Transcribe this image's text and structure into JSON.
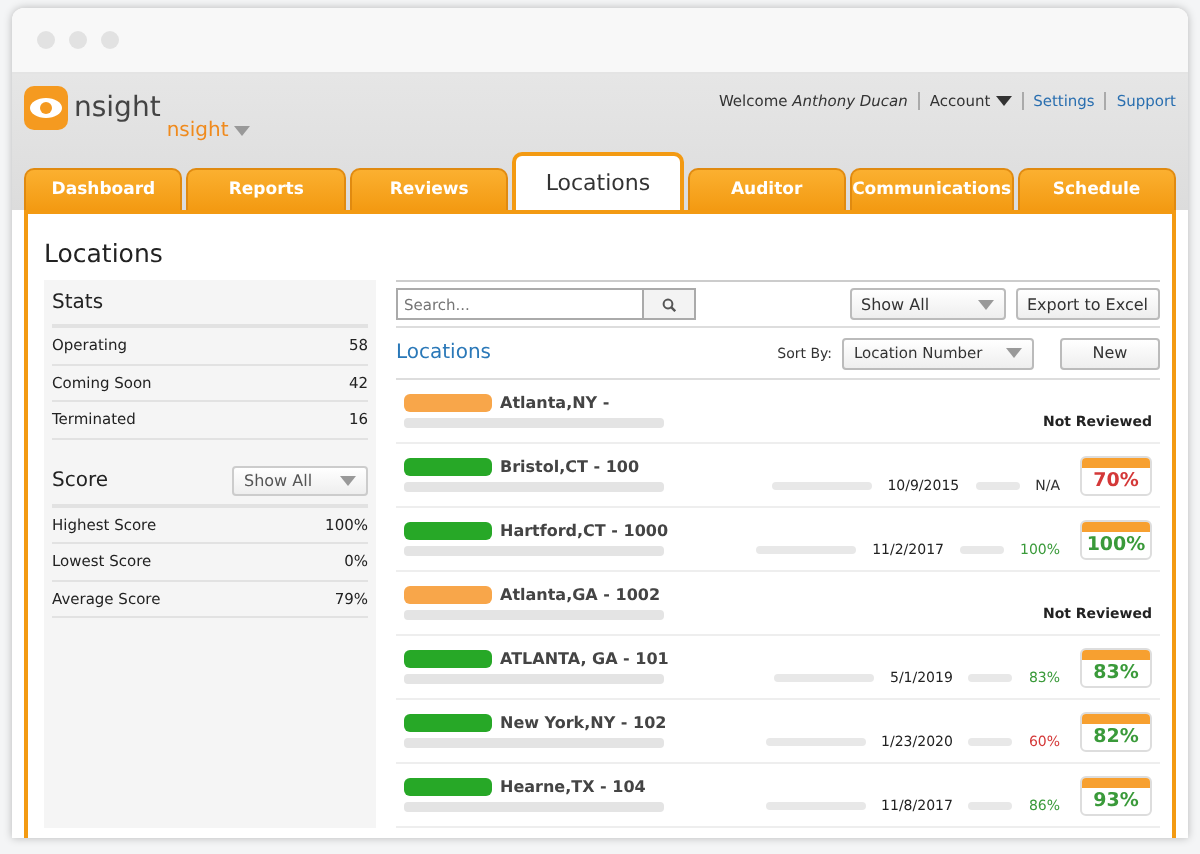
{
  "brand": {
    "name": "nsight",
    "sub": "nsight"
  },
  "user_bar": {
    "welcome": "Welcome",
    "user": "Anthony Ducan",
    "account": "Account",
    "links": [
      "Settings",
      "Support"
    ]
  },
  "tabs": [
    {
      "label": "Dashboard",
      "selected": false
    },
    {
      "label": "Reports",
      "selected": false
    },
    {
      "label": "Reviews",
      "selected": false
    },
    {
      "label": "Locations",
      "selected": true
    },
    {
      "label": "Auditor",
      "selected": false
    },
    {
      "label": "Communications",
      "selected": false
    },
    {
      "label": "Schedule",
      "selected": false
    }
  ],
  "page_title": "Locations",
  "stats": {
    "title": "Stats",
    "rows": [
      {
        "label": "Operating",
        "value": "58"
      },
      {
        "label": "Coming Soon",
        "value": "42"
      },
      {
        "label": "Terminated",
        "value": "16"
      }
    ]
  },
  "score": {
    "title": "Score",
    "filter": "Show All",
    "rows": [
      {
        "label": "Highest Score",
        "value": "100%"
      },
      {
        "label": "Lowest Score",
        "value": "0%"
      },
      {
        "label": "Average Score",
        "value": "79%"
      }
    ]
  },
  "toolbar": {
    "search_placeholder": "Search...",
    "filter": "Show All",
    "export": "Export to Excel"
  },
  "list": {
    "title": "Locations",
    "sort_label": "Sort By:",
    "sort": "Location Number",
    "new": "New"
  },
  "locations": [
    {
      "color": "#f8a64a",
      "name": "Atlanta,NY -",
      "not_reviewed": "Not Reviewed"
    },
    {
      "color": "#27a827",
      "name": "Bristol,CT - 100",
      "date": "10/9/2015",
      "score": {
        "text": "N/A",
        "color": "#333333"
      },
      "big": {
        "text": "70%",
        "color": "#d43838"
      }
    },
    {
      "color": "#27a827",
      "name": "Hartford,CT - 1000",
      "date": "11/2/2017",
      "score": {
        "text": "100%",
        "color": "#3a9a3a"
      },
      "big": {
        "text": "100%",
        "color": "#3a9a3a"
      }
    },
    {
      "color": "#f8a64a",
      "name": "Atlanta,GA - 1002",
      "not_reviewed": "Not Reviewed"
    },
    {
      "color": "#27a827",
      "name": "ATLANTA, GA - 101",
      "date": "5/1/2019",
      "score": {
        "text": "83%",
        "color": "#3a9a3a"
      },
      "big": {
        "text": "83%",
        "color": "#3a9a3a"
      }
    },
    {
      "color": "#27a827",
      "name": "New York,NY - 102",
      "date": "1/23/2020",
      "score": {
        "text": "60%",
        "color": "#d43838"
      },
      "big": {
        "text": "82%",
        "color": "#3a9a3a"
      }
    },
    {
      "color": "#27a827",
      "name": "Hearne,TX - 104",
      "date": "11/8/2017",
      "score": {
        "text": "86%",
        "color": "#3a9a3a"
      },
      "big": {
        "text": "93%",
        "color": "#3a9a3a"
      }
    }
  ]
}
